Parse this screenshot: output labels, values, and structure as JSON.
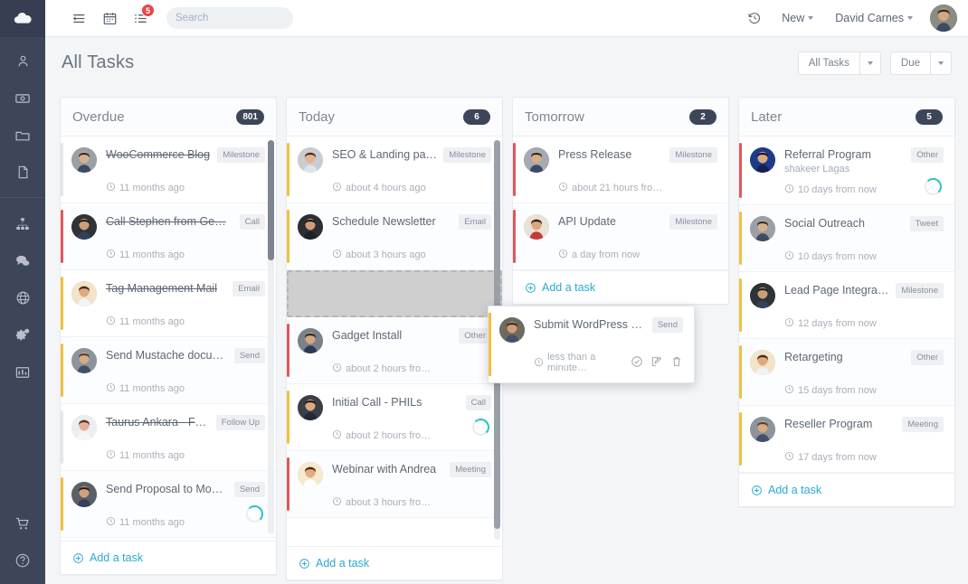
{
  "app": {
    "logo_icon": "cloud-icon",
    "accent_blue": "#2aa9d4",
    "accent_teal": "#27c0c8",
    "badge_red": "#e8454a",
    "rail_bg": "#3d4559",
    "bar_red": "#e0585b",
    "bar_yellow": "#f0c040",
    "bar_gray": "#e3e6ea"
  },
  "rail": {
    "items": [
      {
        "icon": "user-icon",
        "name": "contacts"
      },
      {
        "icon": "money-icon",
        "name": "deals"
      },
      {
        "icon": "folder-icon",
        "name": "projects"
      },
      {
        "icon": "document-icon",
        "name": "documents"
      }
    ],
    "items2": [
      {
        "icon": "org-chart-icon",
        "name": "organization"
      },
      {
        "icon": "chat-icon",
        "name": "messages"
      },
      {
        "icon": "globe-icon",
        "name": "website"
      },
      {
        "icon": "gears-icon",
        "name": "settings"
      },
      {
        "icon": "bar-chart-icon",
        "name": "reports"
      }
    ],
    "bottom": [
      {
        "icon": "cart-icon",
        "name": "store"
      },
      {
        "icon": "help-icon",
        "name": "help"
      }
    ]
  },
  "topbar": {
    "icons": [
      {
        "icon": "list-panel-icon",
        "name": "activity",
        "badge": ""
      },
      {
        "icon": "calendar-icon",
        "name": "calendar",
        "badge": ""
      },
      {
        "icon": "tasks-icon",
        "name": "tasks",
        "badge": "5"
      }
    ],
    "search": {
      "placeholder": "Search",
      "value": "",
      "icon": "search-icon"
    },
    "history_icon": "history-icon",
    "new_label": "New",
    "user_label": "David Carnes",
    "avatar": "user-avatar"
  },
  "page": {
    "title": "All Tasks",
    "filter_label": "All Tasks",
    "sort_label": "Due"
  },
  "board": {
    "add_task_label": "Add a task",
    "columns": [
      {
        "name": "overdue",
        "title": "Overdue",
        "count": "801",
        "add_task": true,
        "cards": [
          {
            "title": "WooCommerce Blog",
            "tag": "Milestone",
            "time": "11 months ago",
            "bar": "gray",
            "done": true,
            "spinner": false
          },
          {
            "title": "Call Stephen from Ge…",
            "tag": "Call",
            "time": "11 months ago",
            "bar": "red",
            "done": true,
            "spinner": false
          },
          {
            "title": "Tag Management Mail",
            "tag": "Email",
            "time": "11 months ago",
            "bar": "yellow",
            "done": true,
            "spinner": false
          },
          {
            "title": "Send Mustache docu…",
            "tag": "Send",
            "time": "11 months ago",
            "bar": "yellow",
            "done": false,
            "spinner": false
          },
          {
            "title": "Taurus Ankara - Foll…",
            "tag": "Follow Up",
            "time": "11 months ago",
            "bar": "gray",
            "done": true,
            "spinner": false
          },
          {
            "title": "Send Proposal to Mo…",
            "tag": "Send",
            "time": "11 months ago",
            "bar": "yellow",
            "done": false,
            "spinner": true
          }
        ]
      },
      {
        "name": "today",
        "title": "Today",
        "count": "6",
        "add_task": true,
        "cards": [
          {
            "title": "SEO & Landing page",
            "tag": "Milestone",
            "time": "about 4 hours ago",
            "bar": "yellow",
            "done": false,
            "spinner": false
          },
          {
            "title": "Schedule Newsletter",
            "tag": "Email",
            "time": "about 3 hours ago",
            "bar": "yellow",
            "done": false,
            "spinner": false
          },
          {
            "placeholder": true
          },
          {
            "title": "Gadget Install",
            "tag": "Other",
            "time": "about 2 hours fro…",
            "bar": "red",
            "done": false,
            "spinner": false
          },
          {
            "title": "Initial Call - PHILs",
            "tag": "Call",
            "time": "about 2 hours fro…",
            "bar": "yellow",
            "done": false,
            "spinner": true
          },
          {
            "title": "Webinar with Andrea",
            "tag": "Meeting",
            "time": "about 3 hours fro…",
            "bar": "red",
            "done": false,
            "spinner": false
          }
        ]
      },
      {
        "name": "tomorrow",
        "title": "Tomorrow",
        "count": "2",
        "add_task": true,
        "cards": [
          {
            "title": "Press Release",
            "tag": "Milestone",
            "time": "about 21 hours fro…",
            "bar": "red",
            "done": false,
            "spinner": false
          },
          {
            "title": "API Update",
            "tag": "Milestone",
            "time": "a day from now",
            "bar": "red",
            "done": false,
            "spinner": false
          }
        ]
      },
      {
        "name": "later",
        "title": "Later",
        "count": "5",
        "add_task": true,
        "cards": [
          {
            "title": "Referral Program",
            "subtitle": "shakeer Lagas",
            "tag": "Other",
            "time": "10 days from now",
            "bar": "red",
            "done": false,
            "spinner": true
          },
          {
            "title": "Social Outreach",
            "tag": "Tweet",
            "time": "10 days from now",
            "bar": "yellow",
            "done": false,
            "spinner": false
          },
          {
            "title": "Lead Page Integration",
            "tag": "Milestone",
            "time": "12 days from now",
            "bar": "yellow",
            "done": false,
            "spinner": false
          },
          {
            "title": "Retargeting",
            "tag": "Other",
            "time": "15 days from now",
            "bar": "yellow",
            "done": false,
            "spinner": false
          },
          {
            "title": "Reseller Program",
            "tag": "Meeting",
            "time": "17 days from now",
            "bar": "yellow",
            "done": false,
            "spinner": false
          }
        ]
      }
    ]
  },
  "drag_card": {
    "title": "Submit WordPress Pl…",
    "tag": "Send",
    "time": "less than a minute…",
    "bar": "yellow",
    "actions": [
      {
        "icon": "check-circle-icon",
        "name": "complete-task"
      },
      {
        "icon": "edit-icon",
        "name": "edit-task"
      },
      {
        "icon": "trash-icon",
        "name": "delete-task"
      }
    ]
  }
}
